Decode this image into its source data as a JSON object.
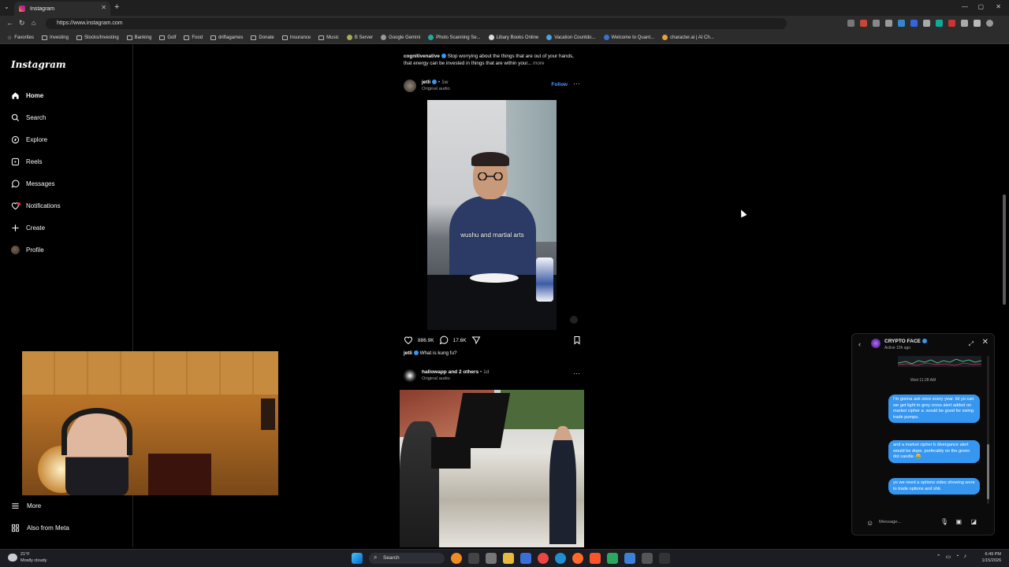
{
  "browser": {
    "tab_title": "Instagram",
    "url": "https://www.instagram.com",
    "bookmarks": [
      {
        "label": "Favorites",
        "icon": "star"
      },
      {
        "label": "Investing",
        "icon": "folder"
      },
      {
        "label": "Stocks/Investing",
        "icon": "folder"
      },
      {
        "label": "Banking",
        "icon": "folder"
      },
      {
        "label": "Golf",
        "icon": "folder"
      },
      {
        "label": "Food",
        "icon": "folder"
      },
      {
        "label": "driftagames",
        "icon": "folder"
      },
      {
        "label": "Donate",
        "icon": "folder"
      },
      {
        "label": "Insurance",
        "icon": "folder"
      },
      {
        "label": "Music",
        "icon": "folder"
      },
      {
        "label": "B Server",
        "icon": "site"
      },
      {
        "label": "Google Gemini",
        "icon": "site"
      },
      {
        "label": "Photo Scanning Se...",
        "icon": "site"
      },
      {
        "label": "Libary Books Online",
        "icon": "site"
      },
      {
        "label": "Vacation Countdo...",
        "icon": "site"
      },
      {
        "label": "Welcome to Quant...",
        "icon": "site"
      },
      {
        "label": "character.ai | AI Ch...",
        "icon": "site"
      }
    ]
  },
  "sidebar": {
    "logo": "Instagram",
    "items": [
      {
        "label": "Home",
        "icon": "home-icon"
      },
      {
        "label": "Search",
        "icon": "search-icon"
      },
      {
        "label": "Explore",
        "icon": "compass-icon"
      },
      {
        "label": "Reels",
        "icon": "reels-icon"
      },
      {
        "label": "Messages",
        "icon": "messages-icon"
      },
      {
        "label": "Notifications",
        "icon": "heart-icon"
      },
      {
        "label": "Create",
        "icon": "plus-icon"
      },
      {
        "label": "Profile",
        "icon": "avatar"
      }
    ],
    "more": "More",
    "meta": "Also from Meta"
  },
  "feed": {
    "prev_caption": {
      "user": "cognitivenative",
      "text": "Stop worrying about the things that are out of your hands, that energy can be invested in things that are within your...",
      "more": "more"
    },
    "post1": {
      "user": "jetli",
      "time": "• 1w",
      "audio": "Original audio",
      "follow": "Follow",
      "subtitle": "wushu and martial arts",
      "likes": "886.9K",
      "comments": "17.6K",
      "caption_user": "jetli",
      "caption": "What is kung fu?"
    },
    "post2": {
      "user": "hallowapp and 2 others",
      "time": "• 1d",
      "audio": "Original audio"
    }
  },
  "chat": {
    "name": "CRYPTO FACE",
    "status": "Active 10h ago",
    "timestamp": "Wed 11:28 AM",
    "messages": [
      "I'm gonna ask once every year. lol yo can we get light to grey cross alert added on market cipher a. would be good for swing trade pumps.",
      "and a market cipher b divergance alert would be dope. preferably on the green dot candle. 😅",
      "yo we need a options video showing were to trade options and shit."
    ],
    "placeholder": "Message..."
  },
  "taskbar": {
    "temp": "21°F",
    "weather": "Mostly cloudy",
    "search": "Search",
    "time": "6:49 PM",
    "date": "1/15/2026"
  }
}
